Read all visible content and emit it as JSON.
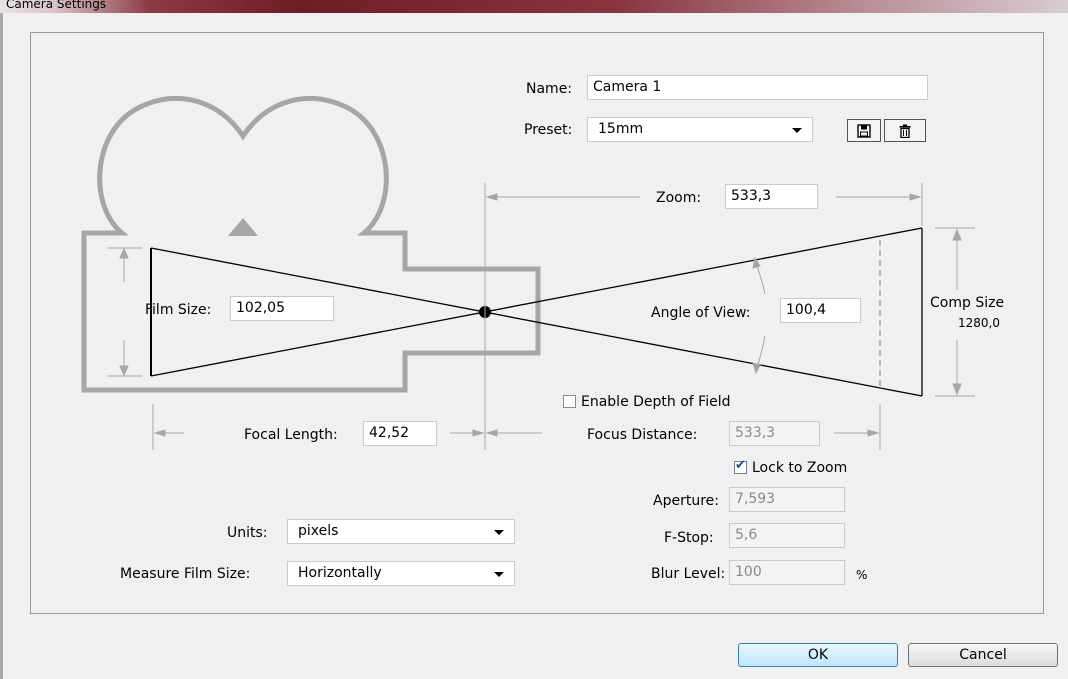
{
  "window": {
    "title": "Camera Settings"
  },
  "name": {
    "label": "Name:",
    "value": "Camera 1"
  },
  "preset": {
    "label": "Preset:",
    "value": "15mm"
  },
  "zoom": {
    "label": "Zoom:",
    "value": "533,3"
  },
  "film_size": {
    "label": "Film Size:",
    "value": "102,05"
  },
  "angle_of_view": {
    "label": "Angle of View:",
    "value": "100,4"
  },
  "comp_size": {
    "label": "Comp Size",
    "value": "1280,0"
  },
  "focal_length": {
    "label": "Focal Length:",
    "value": "42,52"
  },
  "depth_of_field": {
    "label": "Enable Depth of Field",
    "checked": false
  },
  "focus_distance": {
    "label": "Focus Distance:",
    "value": "533,3"
  },
  "lock_to_zoom": {
    "label": "Lock to Zoom",
    "checked": true
  },
  "aperture": {
    "label": "Aperture:",
    "value": "7,593"
  },
  "fstop": {
    "label": "F-Stop:",
    "value": "5,6"
  },
  "blur_level": {
    "label": "Blur Level:",
    "value": "100",
    "unit": "%"
  },
  "units": {
    "label": "Units:",
    "value": "pixels"
  },
  "measure_film_size": {
    "label": "Measure Film Size:",
    "value": "Horizontally"
  },
  "buttons": {
    "ok": "OK",
    "cancel": "Cancel"
  },
  "icons": {
    "save_preset": "save-icon",
    "delete_preset": "trash-icon"
  },
  "colors": {
    "diagram_gray": "#a6a6a6",
    "default_button": "#bee6fd"
  }
}
